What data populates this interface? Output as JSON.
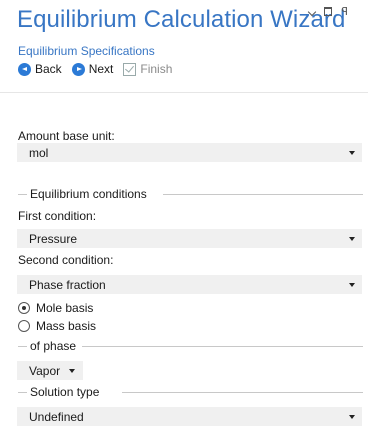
{
  "header": {
    "title": "Equilibrium Calculation Wizard",
    "subtitle": "Equilibrium Specifications"
  },
  "window_controls": {
    "collapse_icon": "chevron-down-icon",
    "maximize_icon": "maximize-icon",
    "pin_icon": "pin-icon"
  },
  "toolbar": {
    "back_label": "Back",
    "next_label": "Next",
    "finish_label": "Finish"
  },
  "form": {
    "amount_base_unit": {
      "label": "Amount base unit:",
      "value": "mol"
    },
    "equilibrium_conditions": {
      "section_title": "Equilibrium conditions",
      "first_condition": {
        "label": "First condition:",
        "value": "Pressure"
      },
      "second_condition": {
        "label": "Second condition:",
        "value": "Phase fraction"
      },
      "basis_options": [
        {
          "label": "Mole basis",
          "selected": true
        },
        {
          "label": "Mass basis",
          "selected": false
        }
      ]
    },
    "of_phase": {
      "section_title": "of phase",
      "value": "Vapor"
    },
    "solution_type": {
      "section_title": "Solution type",
      "value": "Undefined"
    }
  },
  "colors": {
    "accent": "#3876c4",
    "button_icon": "#2b7ad6",
    "select_bg": "#f0f0f0",
    "disabled_text": "#8a8a8a"
  }
}
